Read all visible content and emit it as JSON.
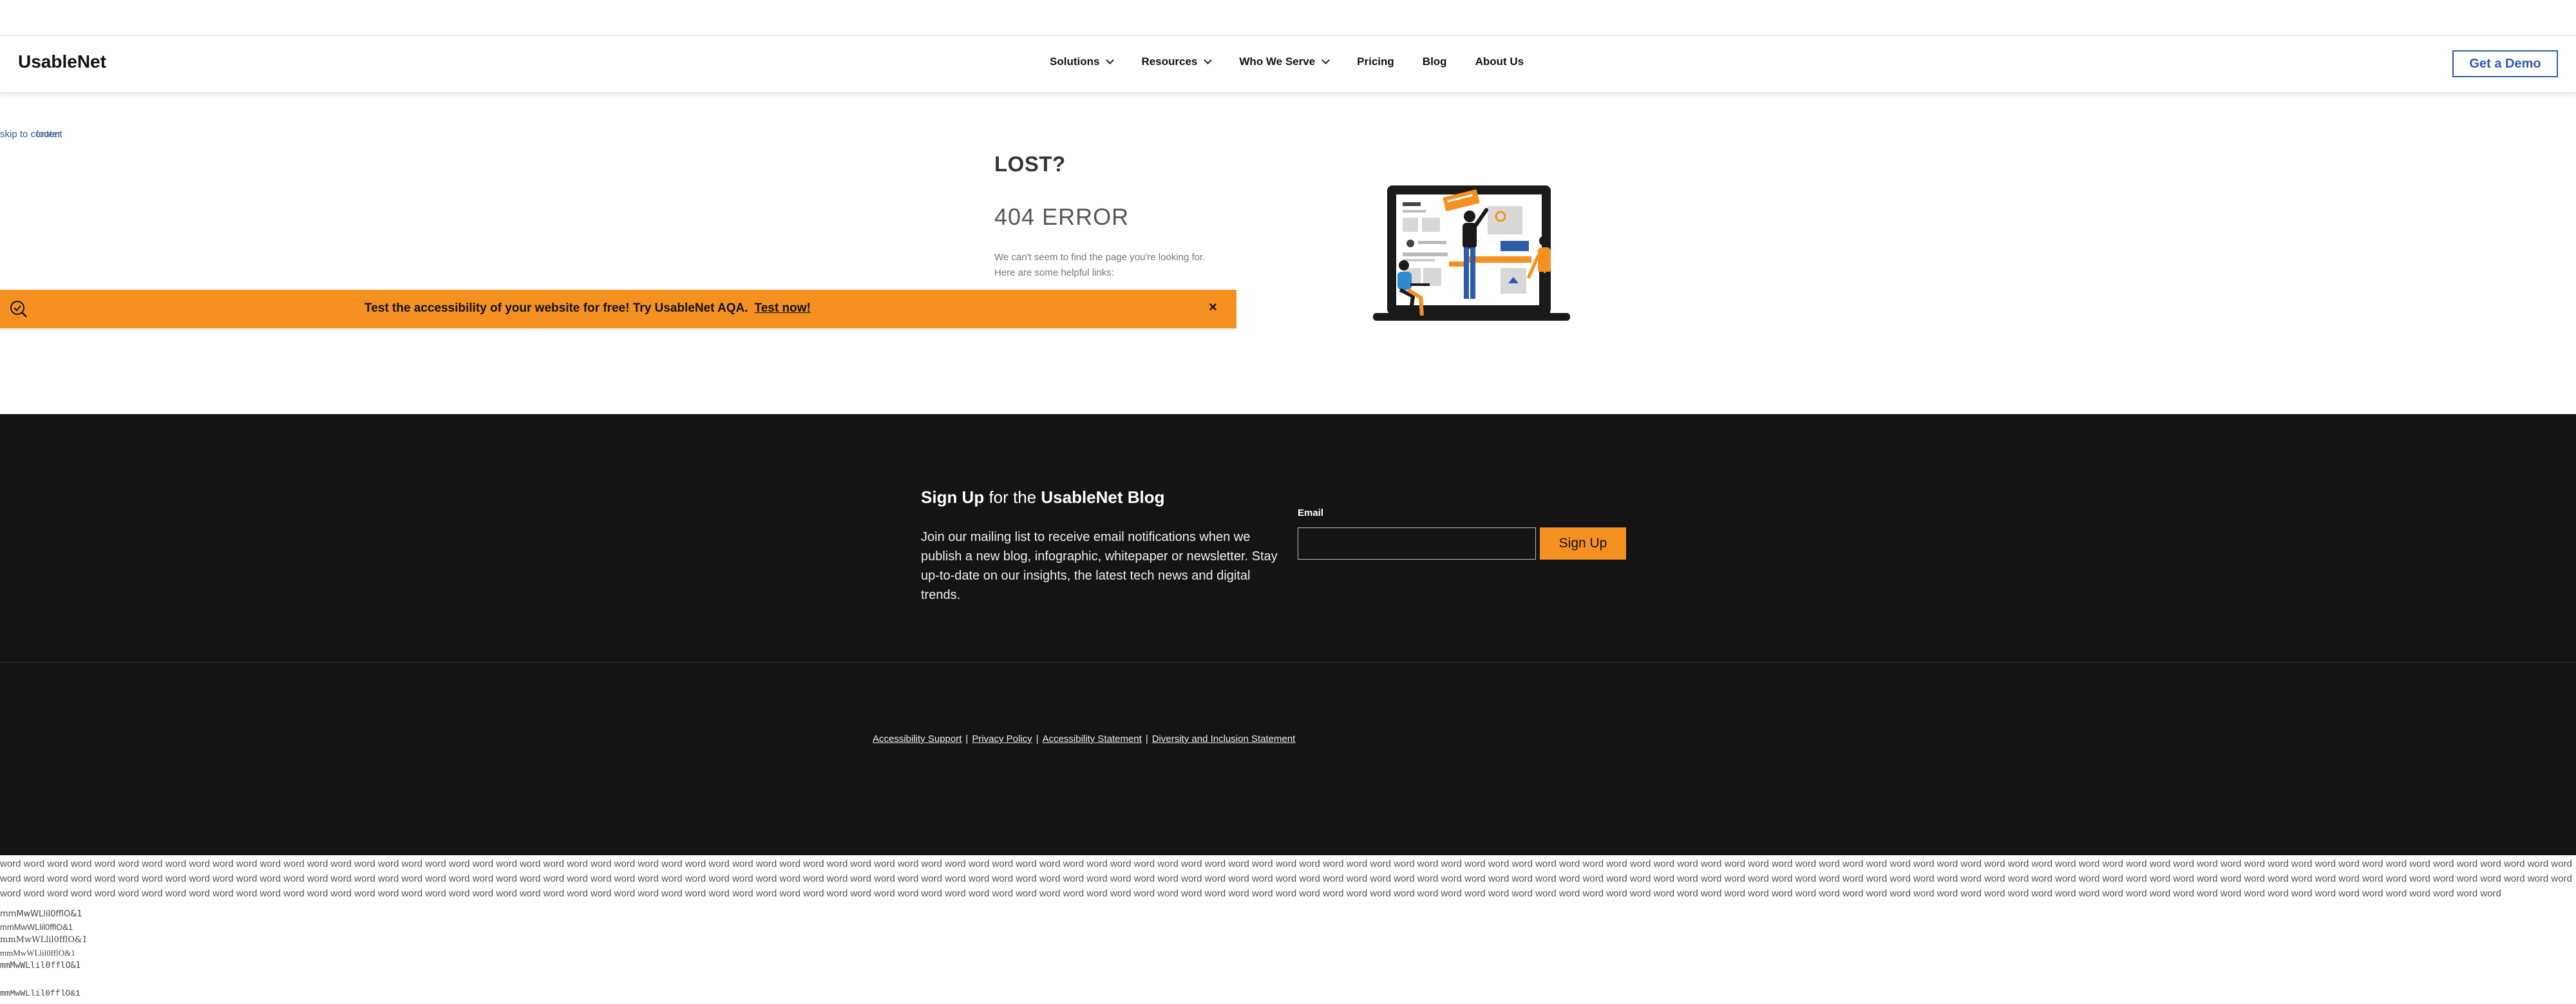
{
  "header": {
    "logo": "UsableNet",
    "nav": [
      {
        "label": "Solutions",
        "dropdown": true
      },
      {
        "label": "Resources",
        "dropdown": true
      },
      {
        "label": "Who We Serve",
        "dropdown": true
      },
      {
        "label": "Pricing",
        "dropdown": false
      },
      {
        "label": "Blog",
        "dropdown": false
      },
      {
        "label": "About Us",
        "dropdown": false
      }
    ],
    "cta": "Get a Demo"
  },
  "skip_link": "skip to content",
  "skip_link_overlay": "footer",
  "error_page": {
    "heading": "LOST?",
    "code": "404 ERROR",
    "message_line1": "We can't seem to find the page you're looking for.",
    "message_line2": "Here are some helpful links:"
  },
  "banner": {
    "text": "Test the accessibility of your website for free! Try UsableNet AQA.",
    "link": "Test now!",
    "close": "×",
    "bg_color": "#f59120"
  },
  "footer": {
    "signup_title_bold1": "Sign Up",
    "signup_title_mid": " for the ",
    "signup_title_bold2": "UsableNet Blog",
    "signup_desc": "Join our mailing list to receive email notifications when we publish a new blog, infographic, whitepaper or newsletter. Stay up-to-date on our insights, the latest tech news and digital trends.",
    "email_label": "Email",
    "email_value": "",
    "signup_button": "Sign Up",
    "links": [
      "Accessibility Support",
      "Privacy Policy",
      "Accessibility Statement",
      "Diversity and Inclusion Statement"
    ],
    "link_separator": "|",
    "bg_color": "#141414"
  },
  "bottom": {
    "words": "word word word word word word word word word word word word word word word word word word word word word word word word word word word word word word word word word word word word word word word word word word word word word word word word word word word word word word word word word word word word word word word word word word word word word word word word word word word word word word word word word word word word word word word word word word word word word word word word word word word word word word word word word word word word word word word word word word word word word word word word word word word word word word word word word word word word word word word word word word word word word word word word word word word word word word word word word word word word word word word word word word word word word word word word word word word word word word word word word word word word word word word word word word word word word word word word word word word word word word word word word word word word word word word word word word word word word word word word word word word word word word word word word word word word word word word word word word word word word word word word word word word word word word word word word word word word word word word word word word word word word word word word word word word word word word word word word word word word word word word word word word word word word word word word word word word word word word word word word word word word word word word word word word word word word word word word word word word word word word word word word word word word",
    "font_samples": [
      "mmMwWLlil0fflO&1",
      "mmMwWLlil0fflO&1",
      "mmMwWLlil0fflO&1",
      "mmMwWLlil0fflO&1",
      "mmMwWLlil0fflO&1"
    ],
    "font_sample_last": "mmMwWLlil0fflO&1"
  }
}
